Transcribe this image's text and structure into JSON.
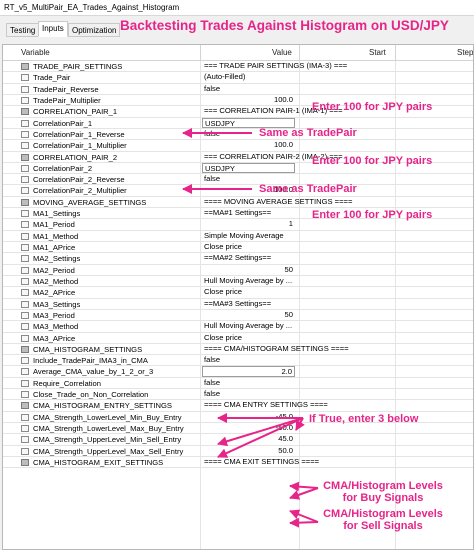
{
  "window": {
    "title": "RT_v5_MultiPair_EA_Trades_Against_Histogram"
  },
  "tabs": [
    {
      "label": "Testing",
      "active": false
    },
    {
      "label": "Inputs",
      "active": true
    },
    {
      "label": "Optimization",
      "active": false
    }
  ],
  "headline": "Backtesting Trades Against Histogram on USD/JPY",
  "grid": {
    "columns": {
      "variable": "Variable",
      "value": "Value",
      "start": "Start",
      "step": "Step"
    },
    "rows": [
      {
        "name": "TRADE_PAIR_SETTINGS",
        "value": "=== TRADE PAIR SETTINGS (IMA-3) ==="
      },
      {
        "name": "Trade_Pair",
        "value": "(Auto-Filled)"
      },
      {
        "name": "TradePair_Reverse",
        "value": "false"
      },
      {
        "name": "TradePair_Multiplier",
        "value": "100.0"
      },
      {
        "name": "CORRELATION_PAIR_1",
        "value": "=== CORRELATION PAIR-1 (IMA-1) ==="
      },
      {
        "name": "CorrelationPair_1",
        "value": "USDJPY"
      },
      {
        "name": "CorrelationPair_1_Reverse",
        "value": "false"
      },
      {
        "name": "CorrelationPair_1_Multiplier",
        "value": "100.0"
      },
      {
        "name": "CORRELATION_PAIR_2",
        "value": "=== CORRELATION PAIR-2 (IMA-2) ==="
      },
      {
        "name": "CorrelationPair_2",
        "value": "USDJPY"
      },
      {
        "name": "CorrelationPair_2_Reverse",
        "value": "false"
      },
      {
        "name": "CorrelationPair_2_Multiplier",
        "value": "100.0"
      },
      {
        "name": "MOVING_AVERAGE_SETTINGS",
        "value": "==== MOVING AVERAGE SETTINGS ===="
      },
      {
        "name": "MA1_Settings",
        "value": "==MA#1 Settings=="
      },
      {
        "name": "MA1_Period",
        "value": "1"
      },
      {
        "name": "MA1_Method",
        "value": "Simple Moving Average"
      },
      {
        "name": "MA1_APrice",
        "value": "Close price"
      },
      {
        "name": "MA2_Settings",
        "value": "==MA#2 Settings=="
      },
      {
        "name": "MA2_Period",
        "value": "50"
      },
      {
        "name": "MA2_Method",
        "value": "Hull Moving Average by ..."
      },
      {
        "name": "MA2_APrice",
        "value": "Close price"
      },
      {
        "name": "MA3_Settings",
        "value": "==MA#3 Settings=="
      },
      {
        "name": "MA3_Period",
        "value": "50"
      },
      {
        "name": "MA3_Method",
        "value": "Hull Moving Average by ..."
      },
      {
        "name": "MA3_APrice",
        "value": "Close price"
      },
      {
        "name": "CMA_HISTOGRAM_SETTINGS",
        "value": "==== CMA/HISTOGRAM SETTINGS ===="
      },
      {
        "name": "Include_TradePair_IMA3_in_CMA",
        "value": "false"
      },
      {
        "name": "Average_CMA_value_by_1_2_or_3",
        "value": "2.0"
      },
      {
        "name": "Require_Correlation",
        "value": "false"
      },
      {
        "name": "Close_Trade_on_Non_Correlation",
        "value": "false"
      },
      {
        "name": "CMA_HISTOGRAM_ENTRY_SETTINGS",
        "value": "==== CMA ENTRY SETTINGS ===="
      },
      {
        "name": "CMA_Strength_LowerLevel_Min_Buy_Entry",
        "value": "-45.0"
      },
      {
        "name": "CMA_Strength_LowerLevel_Max_Buy_Entry",
        "value": "-50.0"
      },
      {
        "name": "CMA_Strength_UpperLevel_Min_Sell_Entry",
        "value": "45.0"
      },
      {
        "name": "CMA_Strength_UpperLevel_Max_Sell_Entry",
        "value": "50.0"
      },
      {
        "name": "CMA_HISTOGRAM_EXIT_SETTINGS",
        "value": "==== CMA EXIT SETTINGS ===="
      }
    ]
  },
  "annotations": {
    "jpy1": "Enter 100 for JPY pairs",
    "same1": "Same as TradePair",
    "jpy2": "Enter 100 for JPY pairs",
    "same2": "Same as TradePair",
    "jpy3": "Enter 100 for JPY pairs",
    "iftrue": "If True, enter 3 below",
    "buy1": "CMA/Histogram Levels",
    "buy2": "for Buy Signals",
    "sell1": "CMA/Histogram Levels",
    "sell2": "for Sell Signals"
  },
  "colors": {
    "annotation": "#e6248a"
  }
}
